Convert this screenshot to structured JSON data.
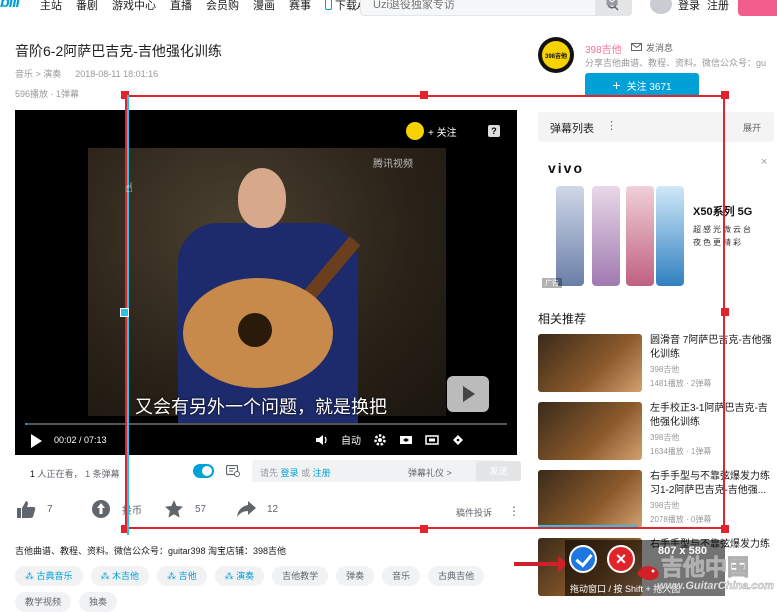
{
  "nav": {
    "logo": "bili",
    "items": [
      "主站",
      "番剧",
      "游戏中心",
      "直播",
      "会员购",
      "漫画",
      "赛事"
    ],
    "download": "下载APP",
    "search_placeholder": "Uzi退役独家专访",
    "login": "登录",
    "register": "注册"
  },
  "video": {
    "title": "音阶6-2阿萨巴吉克-吉他强化训练",
    "category": "音乐 > 演奏",
    "date": "2018-08-11 18:01:16",
    "stats": "596播放 · 1弹幕"
  },
  "uploader": {
    "name": "398吉他",
    "message": "发消息",
    "description": "分享吉他曲谱、教程、资料。微信公众号：gu",
    "follow": "关注 3671",
    "avatar_text": "398吉他"
  },
  "player": {
    "watermark": "腾讯视频",
    "subtitle": "又会有另外一个问题，就是换把",
    "follow": "+ 关注",
    "help": "?",
    "time": "00:02 / 07:13",
    "auto": "自动",
    "progress": 0.005
  },
  "danmaku_bar": {
    "watching_count": "1",
    "watching_text": "人正在看，",
    "danmaku_count": "1 条弹幕",
    "placeholder_prefix": "请先",
    "login": "登录",
    "or": "或",
    "register": "注册",
    "etiquette": "弹幕礼仪 >",
    "send": "发送"
  },
  "actions": {
    "like": "7",
    "coin": "投币",
    "favorite": "57",
    "share": "12",
    "report": "稿件投诉"
  },
  "description": "吉他曲谱、教程、资料。微信公众号：guitar398 淘宝店铺：398吉他",
  "tags": [
    {
      "label": "古典音乐",
      "blue": true
    },
    {
      "label": "木吉他",
      "blue": true
    },
    {
      "label": "吉他",
      "blue": true
    },
    {
      "label": "演奏",
      "blue": true
    },
    {
      "label": "吉他教学",
      "blue": false
    },
    {
      "label": "弹奏",
      "blue": false
    },
    {
      "label": "音乐",
      "blue": false
    },
    {
      "label": "古典吉他",
      "blue": false
    }
  ],
  "tags_row2": [
    "教学视频",
    "独奏"
  ],
  "sidebar": {
    "danmaku_list": "弹幕列表",
    "expand": "展开",
    "ad": {
      "brand": "vivo",
      "model": "X50系列 5G",
      "slogan": "超感光微云台 夜色更精彩",
      "tag": "广告"
    },
    "related_title": "相关推荐",
    "related": [
      {
        "title": "圆滑音 7阿萨巴吉克-吉他强化训练",
        "uploader": "398吉他",
        "stats": "1481播放 · 2弹幕"
      },
      {
        "title": "左手校正3-1阿萨巴吉克-吉他强化训练",
        "uploader": "398吉他",
        "stats": "1634播放 · 1弹幕"
      },
      {
        "title": "右手手型与不靠弦爆发力练习1-2阿萨巴吉克-吉他强...",
        "uploader": "398吉他",
        "stats": "2078播放 · 0弹幕"
      },
      {
        "title": "右手手型与不靠弦爆发力练",
        "uploader": "",
        "stats": ""
      }
    ]
  },
  "capture": {
    "size": "807 x 580",
    "hint": "拖动窗口 / 按 Shift + 拖大图",
    "cancel": "×"
  },
  "watermark": {
    "big": "吉他中国",
    "small": "www.GuitarChina.com"
  },
  "colors": {
    "brand_blue": "#00a1d6",
    "pink": "#fb7299",
    "selection_red": "#e0242a",
    "guide_cyan": "#29c3e8"
  }
}
